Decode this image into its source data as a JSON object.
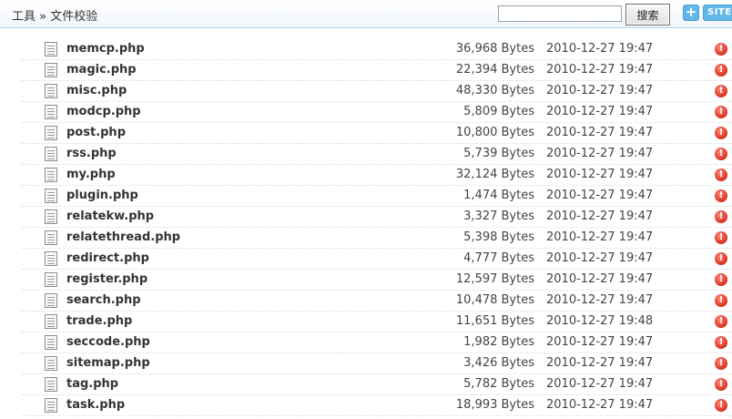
{
  "header": {
    "breadcrumb": "工具 » 文件校验",
    "search_value": "",
    "search_button": "搜索",
    "add_icon_label": "+",
    "site_button": "SITE"
  },
  "files": [
    {
      "name": "memcp.php",
      "size": "36,968 Bytes",
      "date": "2010-12-27 19:47"
    },
    {
      "name": "magic.php",
      "size": "22,394 Bytes",
      "date": "2010-12-27 19:47"
    },
    {
      "name": "misc.php",
      "size": "48,330 Bytes",
      "date": "2010-12-27 19:47"
    },
    {
      "name": "modcp.php",
      "size": "5,809 Bytes",
      "date": "2010-12-27 19:47"
    },
    {
      "name": "post.php",
      "size": "10,800 Bytes",
      "date": "2010-12-27 19:47"
    },
    {
      "name": "rss.php",
      "size": "5,739 Bytes",
      "date": "2010-12-27 19:47"
    },
    {
      "name": "my.php",
      "size": "32,124 Bytes",
      "date": "2010-12-27 19:47"
    },
    {
      "name": "plugin.php",
      "size": "1,474 Bytes",
      "date": "2010-12-27 19:47"
    },
    {
      "name": "relatekw.php",
      "size": "3,327 Bytes",
      "date": "2010-12-27 19:47"
    },
    {
      "name": "relatethread.php",
      "size": "5,398 Bytes",
      "date": "2010-12-27 19:47"
    },
    {
      "name": "redirect.php",
      "size": "4,777 Bytes",
      "date": "2010-12-27 19:47"
    },
    {
      "name": "register.php",
      "size": "12,597 Bytes",
      "date": "2010-12-27 19:47"
    },
    {
      "name": "search.php",
      "size": "10,478 Bytes",
      "date": "2010-12-27 19:47"
    },
    {
      "name": "trade.php",
      "size": "11,651 Bytes",
      "date": "2010-12-27 19:48"
    },
    {
      "name": "seccode.php",
      "size": "1,982 Bytes",
      "date": "2010-12-27 19:47"
    },
    {
      "name": "sitemap.php",
      "size": "3,426 Bytes",
      "date": "2010-12-27 19:47"
    },
    {
      "name": "tag.php",
      "size": "5,782 Bytes",
      "date": "2010-12-27 19:47"
    },
    {
      "name": "task.php",
      "size": "18,993 Bytes",
      "date": "2010-12-27 19:47"
    }
  ],
  "icons": {
    "file": "document-icon",
    "status": "warning-icon",
    "status_glyph": "!"
  }
}
